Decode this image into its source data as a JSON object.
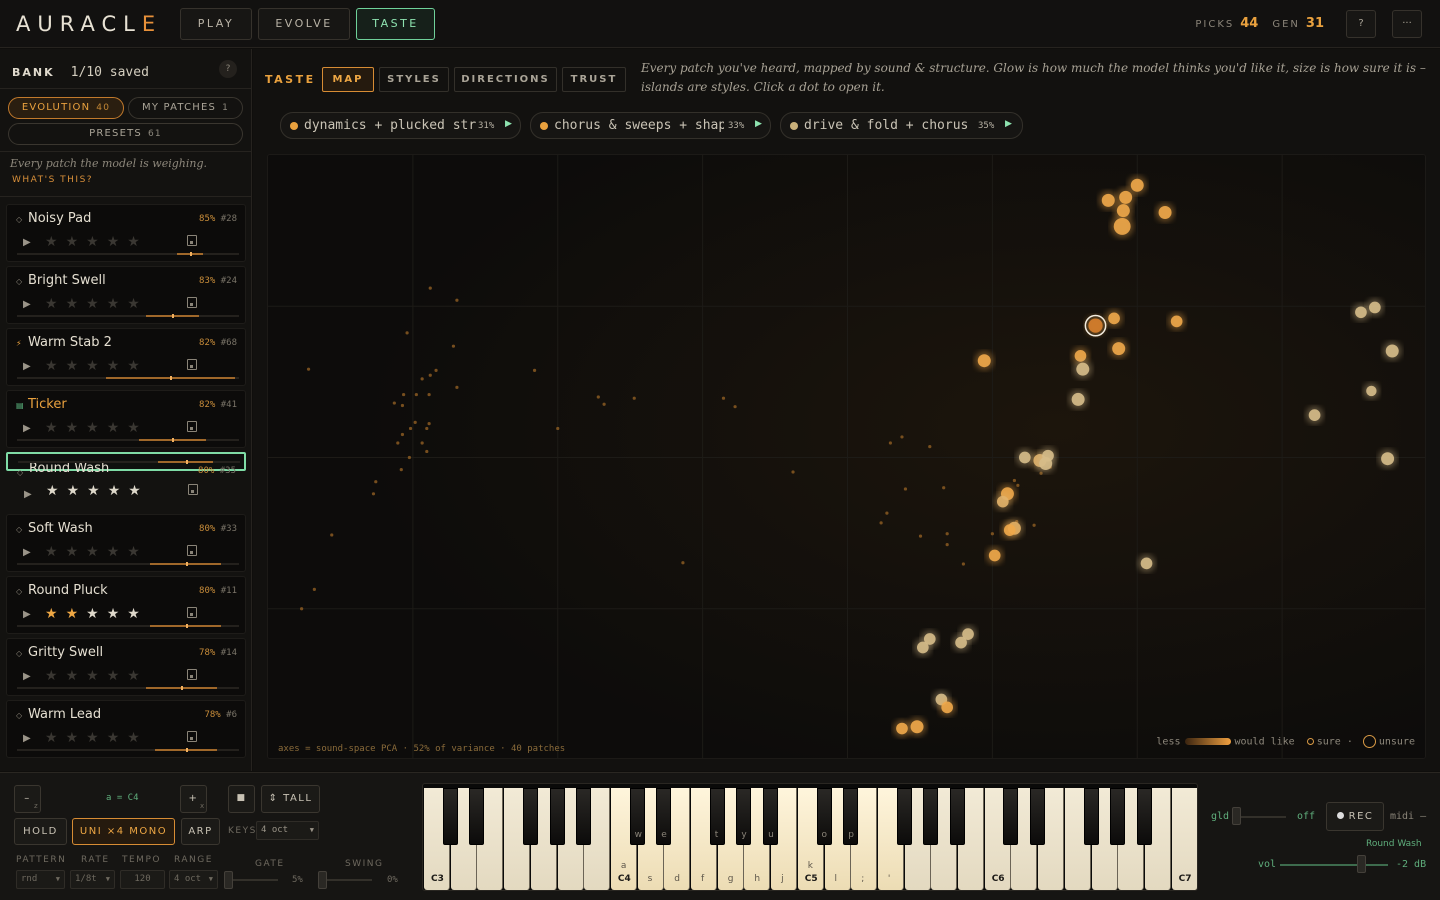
{
  "app": {
    "logo": "AURACLE",
    "nav": [
      "PLAY",
      "EVOLVE",
      "TASTE"
    ],
    "active_nav": "TASTE",
    "picks_label": "PICKS",
    "picks": "44",
    "gen_label": "GEN",
    "gen": "31",
    "help": "?",
    "more": "···"
  },
  "bank": {
    "label": "BANK",
    "count": "1/10 saved",
    "help": "?",
    "tabs": [
      {
        "label": "EVOLUTION",
        "count": "40"
      },
      {
        "label": "MY PATCHES",
        "count": "1"
      }
    ],
    "presets": {
      "label": "PRESETS",
      "count": "61"
    },
    "blurb": "Every patch the model is weighing.",
    "whatis": "WHAT'S THIS?"
  },
  "patches": [
    {
      "name": "Noisy Pad",
      "pct": "85%",
      "id": "#28",
      "stars": 0,
      "marker": "◇",
      "bar": [
        0.72,
        0.84
      ]
    },
    {
      "name": "Bright Swell",
      "pct": "83%",
      "id": "#24",
      "stars": 0,
      "marker": "◇",
      "bar": [
        0.58,
        0.82
      ]
    },
    {
      "name": "Warm Stab 2",
      "pct": "82%",
      "id": "#68",
      "stars": 0,
      "marker": "⚡",
      "bar": [
        0.4,
        0.98
      ]
    },
    {
      "name": "Ticker",
      "pct": "82%",
      "id": "#41",
      "stars": 0,
      "marker": "▤",
      "bar": [
        0.55,
        0.85
      ]
    },
    {
      "name": "Round Wash",
      "pct": "80%",
      "id": "#35",
      "stars": 5,
      "star_color": "white",
      "marker": "◇",
      "bar": [
        0.63,
        0.88
      ]
    },
    {
      "name": "Soft Wash",
      "pct": "80%",
      "id": "#33",
      "stars": 0,
      "marker": "◇",
      "bar": [
        0.6,
        0.92
      ]
    },
    {
      "name": "Round Pluck",
      "pct": "80%",
      "id": "#11",
      "stars": 2,
      "star_color": "orange",
      "marker": "◇",
      "extra_white": 3,
      "bar": [
        0.6,
        0.92
      ]
    },
    {
      "name": "Gritty Swell",
      "pct": "78%",
      "id": "#14",
      "stars": 0,
      "marker": "◇",
      "bar": [
        0.58,
        0.9
      ]
    },
    {
      "name": "Warm Lead",
      "pct": "78%",
      "id": "#6",
      "stars": 0,
      "marker": "◇",
      "bar": [
        0.62,
        0.9
      ]
    }
  ],
  "taste": {
    "label": "TASTE",
    "tabs": [
      "MAP",
      "STYLES",
      "DIRECTIONS",
      "TRUST"
    ],
    "active_tab": "MAP",
    "description": "Every patch you've heard, mapped by sound & structure. Glow is how much the model thinks you'd like it, size is how sure it is – islands are styles. Click a dot to open it."
  },
  "directions": [
    {
      "text": "dynamics + plucked str",
      "pct": "31%",
      "color": "#e9a13e"
    },
    {
      "text": "chorus & sweeps + shap",
      "pct": "33%",
      "color": "#e9a13e"
    },
    {
      "text": "drive & fold + chorus",
      "pct": "35%",
      "color": "#c9b07a"
    }
  ],
  "map": {
    "axes_note": "axes = sound-space PCA · 52% of variance · 40 patches",
    "legend": {
      "less": "less",
      "would_like": "would like",
      "sure": "sure",
      "unsure": "unsure"
    }
  },
  "chart_data": {
    "type": "scatter",
    "xlabel": "",
    "ylabel": "",
    "note": "axes = sound-space PCA · 52% of variance · 40 patches",
    "points": [
      {
        "x": 0.75,
        "y": 0.95,
        "s": 1,
        "l": 1
      },
      {
        "x": 0.74,
        "y": 0.93,
        "s": 1,
        "l": 1
      },
      {
        "x": 0.725,
        "y": 0.925,
        "s": 1,
        "l": 1
      },
      {
        "x": 0.738,
        "y": 0.908,
        "s": 1,
        "l": 1
      },
      {
        "x": 0.737,
        "y": 0.882,
        "s": 1.3,
        "l": 1
      },
      {
        "x": 0.774,
        "y": 0.905,
        "s": 1,
        "l": 0.9
      },
      {
        "x": 0.714,
        "y": 0.718,
        "s": 1.1,
        "l": 1,
        "sel": true
      },
      {
        "x": 0.73,
        "y": 0.73,
        "s": 0.9,
        "l": 1
      },
      {
        "x": 0.784,
        "y": 0.725,
        "s": 0.9,
        "l": 0.9
      },
      {
        "x": 0.734,
        "y": 0.68,
        "s": 1,
        "l": 1
      },
      {
        "x": 0.701,
        "y": 0.668,
        "s": 0.9,
        "l": 0.9
      },
      {
        "x": 0.703,
        "y": 0.646,
        "s": 1,
        "l": 0.7
      },
      {
        "x": 0.699,
        "y": 0.596,
        "s": 1,
        "l": 0.7
      },
      {
        "x": 0.618,
        "y": 0.66,
        "s": 1,
        "l": 1
      },
      {
        "x": 0.943,
        "y": 0.74,
        "s": 0.9,
        "l": 0.6
      },
      {
        "x": 0.955,
        "y": 0.748,
        "s": 0.9,
        "l": 0.6
      },
      {
        "x": 0.97,
        "y": 0.676,
        "s": 1,
        "l": 0.6
      },
      {
        "x": 0.952,
        "y": 0.61,
        "s": 0.8,
        "l": 0.6
      },
      {
        "x": 0.903,
        "y": 0.57,
        "s": 0.9,
        "l": 0.6
      },
      {
        "x": 0.966,
        "y": 0.498,
        "s": 1,
        "l": 0.6
      },
      {
        "x": 0.653,
        "y": 0.5,
        "s": 0.9,
        "l": 0.7
      },
      {
        "x": 0.666,
        "y": 0.495,
        "s": 1,
        "l": 0.8
      },
      {
        "x": 0.673,
        "y": 0.503,
        "s": 0.9,
        "l": 0.7
      },
      {
        "x": 0.671,
        "y": 0.49,
        "s": 1,
        "l": 0.7
      },
      {
        "x": 0.638,
        "y": 0.44,
        "s": 1,
        "l": 1
      },
      {
        "x": 0.634,
        "y": 0.427,
        "s": 0.9,
        "l": 0.8
      },
      {
        "x": 0.644,
        "y": 0.383,
        "s": 1,
        "l": 0.8
      },
      {
        "x": 0.64,
        "y": 0.38,
        "s": 0.9,
        "l": 1
      },
      {
        "x": 0.627,
        "y": 0.338,
        "s": 0.9,
        "l": 1
      },
      {
        "x": 0.758,
        "y": 0.325,
        "s": 0.9,
        "l": 0.6
      },
      {
        "x": 0.571,
        "y": 0.2,
        "s": 0.9,
        "l": 0.7
      },
      {
        "x": 0.565,
        "y": 0.186,
        "s": 0.9,
        "l": 0.7
      },
      {
        "x": 0.604,
        "y": 0.208,
        "s": 0.9,
        "l": 0.7
      },
      {
        "x": 0.598,
        "y": 0.194,
        "s": 0.9,
        "l": 0.7
      },
      {
        "x": 0.581,
        "y": 0.1,
        "s": 0.9,
        "l": 0.7
      },
      {
        "x": 0.586,
        "y": 0.087,
        "s": 0.9,
        "l": 0.9
      },
      {
        "x": 0.56,
        "y": 0.055,
        "s": 1,
        "l": 1
      },
      {
        "x": 0.547,
        "y": 0.052,
        "s": 0.9,
        "l": 1
      }
    ]
  },
  "faint_dots": [
    [
      0.14,
      0.78
    ],
    [
      0.163,
      0.76
    ],
    [
      0.12,
      0.706
    ],
    [
      0.16,
      0.684
    ],
    [
      0.035,
      0.646
    ],
    [
      0.145,
      0.644
    ],
    [
      0.14,
      0.636
    ],
    [
      0.133,
      0.63
    ],
    [
      0.163,
      0.616
    ],
    [
      0.23,
      0.644
    ],
    [
      0.117,
      0.604
    ],
    [
      0.128,
      0.604
    ],
    [
      0.139,
      0.604
    ],
    [
      0.109,
      0.59
    ],
    [
      0.116,
      0.586
    ],
    [
      0.127,
      0.558
    ],
    [
      0.139,
      0.556
    ],
    [
      0.123,
      0.548
    ],
    [
      0.137,
      0.548
    ],
    [
      0.116,
      0.538
    ],
    [
      0.112,
      0.524
    ],
    [
      0.133,
      0.524
    ],
    [
      0.137,
      0.51
    ],
    [
      0.122,
      0.5
    ],
    [
      0.115,
      0.48
    ],
    [
      0.093,
      0.46
    ],
    [
      0.091,
      0.44
    ],
    [
      0.055,
      0.372
    ],
    [
      0.04,
      0.282
    ],
    [
      0.029,
      0.25
    ],
    [
      0.29,
      0.588
    ],
    [
      0.25,
      0.548
    ],
    [
      0.285,
      0.6
    ],
    [
      0.316,
      0.598
    ],
    [
      0.393,
      0.598
    ],
    [
      0.403,
      0.584
    ],
    [
      0.453,
      0.476
    ],
    [
      0.358,
      0.326
    ],
    [
      0.537,
      0.524
    ],
    [
      0.547,
      0.534
    ],
    [
      0.571,
      0.518
    ],
    [
      0.55,
      0.448
    ],
    [
      0.534,
      0.408
    ],
    [
      0.529,
      0.392
    ],
    [
      0.563,
      0.37
    ],
    [
      0.586,
      0.356
    ],
    [
      0.647,
      0.454
    ],
    [
      0.646,
      0.394
    ],
    [
      0.661,
      0.388
    ],
    [
      0.644,
      0.462
    ],
    [
      0.667,
      0.474
    ],
    [
      0.675,
      0.484
    ],
    [
      0.625,
      0.374
    ],
    [
      0.6,
      0.324
    ],
    [
      0.586,
      0.374
    ],
    [
      0.583,
      0.45
    ]
  ],
  "keyboard": {
    "minus": "–",
    "minus_sub": "z",
    "octave": "a = C4",
    "plus": "+",
    "plus_sub": "x",
    "stop": "■",
    "tall": "⇕ TALL",
    "hold": "HOLD",
    "mode": "UNI ×4 MONO",
    "arp": "ARP",
    "keys_label": "KEYS",
    "keys_value": "4 oct",
    "pattern_label": "PATTERN",
    "pattern_value": "rnd",
    "rate_label": "RATE",
    "rate_value": "1/8t",
    "tempo_label": "TEMPO",
    "tempo_value": "120",
    "range_label": "RANGE",
    "range_value": "4 oct",
    "gate_label": "GATE",
    "gate_value": "5%",
    "swing_label": "SWING",
    "swing_value": "0%",
    "white_labels": [
      "C3",
      "",
      "",
      "",
      "",
      "",
      "",
      "",
      "a",
      "s",
      "d",
      "f",
      "g",
      "h",
      "j",
      "k",
      "l",
      ";",
      "'",
      "",
      "",
      "",
      "",
      "",
      "",
      "",
      "",
      "C7"
    ],
    "octave_labels": [
      {
        "i": 0,
        "t": "C3"
      },
      {
        "i": 7,
        "t": "C4"
      },
      {
        "i": 14,
        "t": "C5"
      },
      {
        "i": 21,
        "t": "C6"
      },
      {
        "i": 28,
        "t": "C7"
      }
    ],
    "white_letters": [
      "a",
      "s",
      "d",
      "f",
      "g",
      "h",
      "j",
      "k",
      "l",
      ";",
      "'"
    ],
    "black_letters": [
      "w",
      "e",
      "t",
      "y",
      "u",
      "o",
      "p"
    ]
  },
  "synth": {
    "gld_label": "gld",
    "gld_value": "off",
    "rec": "REC",
    "midi": "midi –",
    "patch_name": "Round Wash",
    "vol_label": "vol",
    "vol_value": "-2 dB"
  }
}
